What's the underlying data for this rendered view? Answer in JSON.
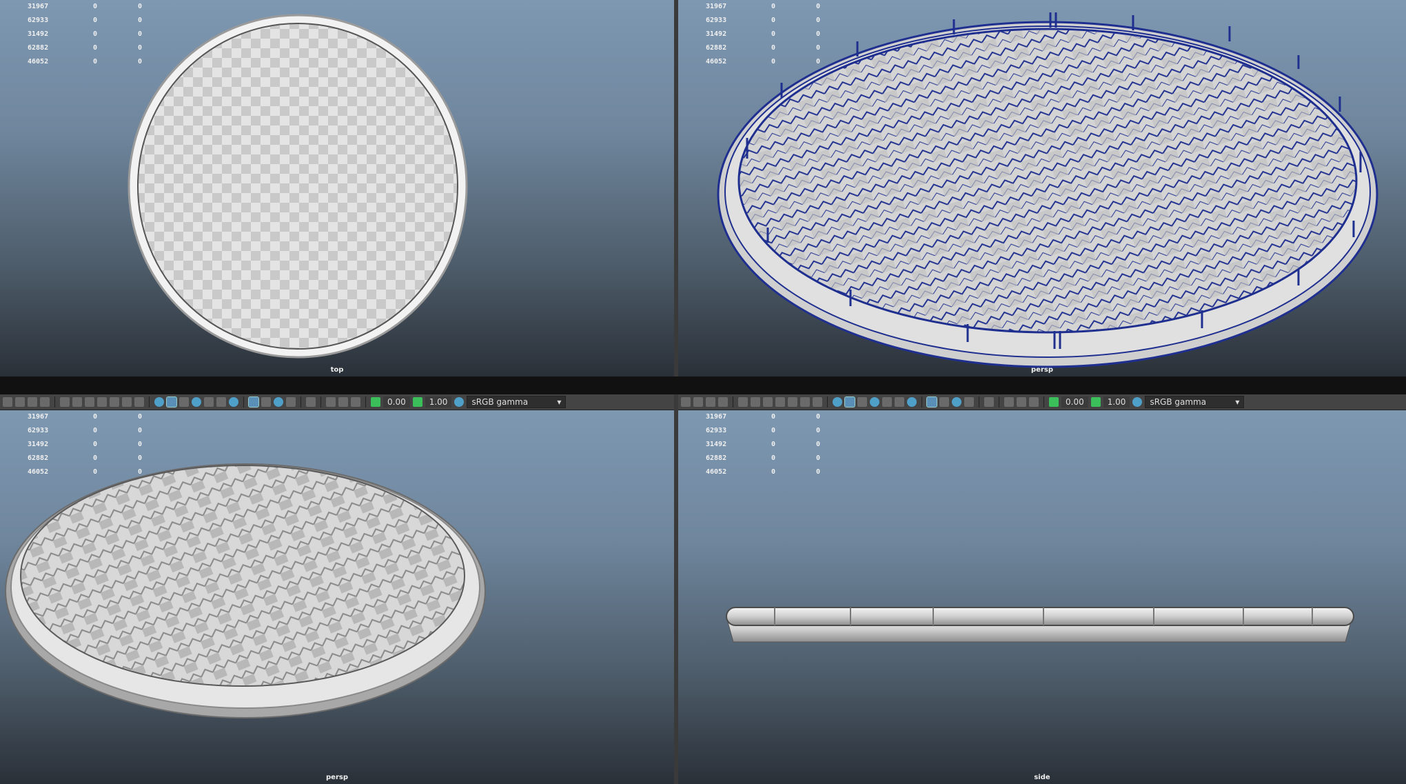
{
  "stats_rows": [
    [
      "31967",
      "0",
      "0"
    ],
    [
      "62933",
      "0",
      "0"
    ],
    [
      "31492",
      "0",
      "0"
    ],
    [
      "62882",
      "0",
      "0"
    ],
    [
      "46052",
      "0",
      "0"
    ]
  ],
  "viewports": {
    "top": {
      "label": "top"
    },
    "persp_wire": {
      "label": "persp"
    },
    "persp_shaded": {
      "label": "persp"
    },
    "side": {
      "label": "side"
    }
  },
  "toolbar": {
    "exposure": "0.00",
    "gamma": "1.00",
    "color_space": "sRGB gamma"
  },
  "colors": {
    "viewport_top": "#7e98b2",
    "viewport_bottom": "#2a3038",
    "wireframe": "#1f2f8f",
    "model": "#d8d8d8"
  }
}
